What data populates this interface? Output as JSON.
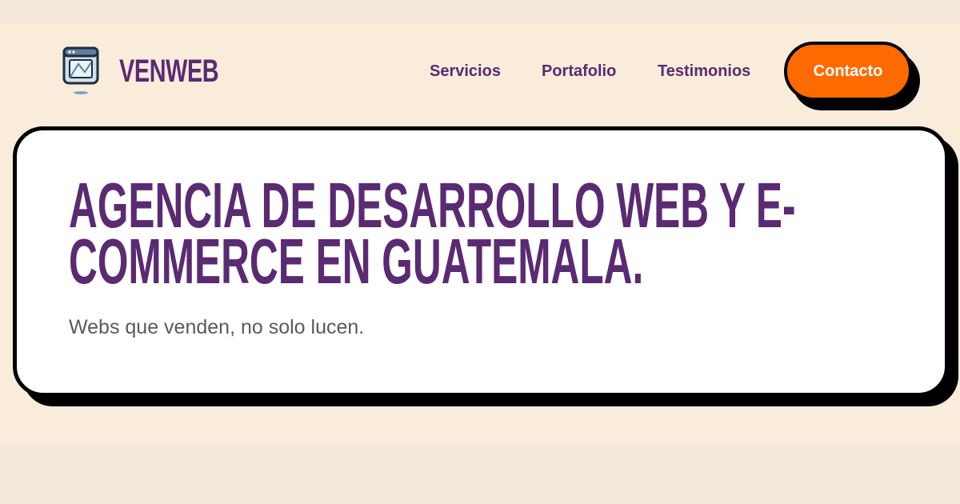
{
  "header": {
    "brand": "VENWEB",
    "logo_icon": "browser-window-icon",
    "nav": [
      {
        "label": "Servicios"
      },
      {
        "label": "Portafolio"
      },
      {
        "label": "Testimonios"
      }
    ],
    "cta_label": "Contacto"
  },
  "hero": {
    "headline_line1": "AGENCIA DE DESARROLLO WEB Y E-",
    "headline_line2": "COMMERCE EN GUATEMALA.",
    "subline": "Webs que venden, no solo lucen."
  },
  "colors": {
    "background": "#f5ead9",
    "brand_purple": "#5a2a72",
    "accent_orange": "#ff6a00",
    "card": "#ffffff",
    "outline": "#000000"
  }
}
